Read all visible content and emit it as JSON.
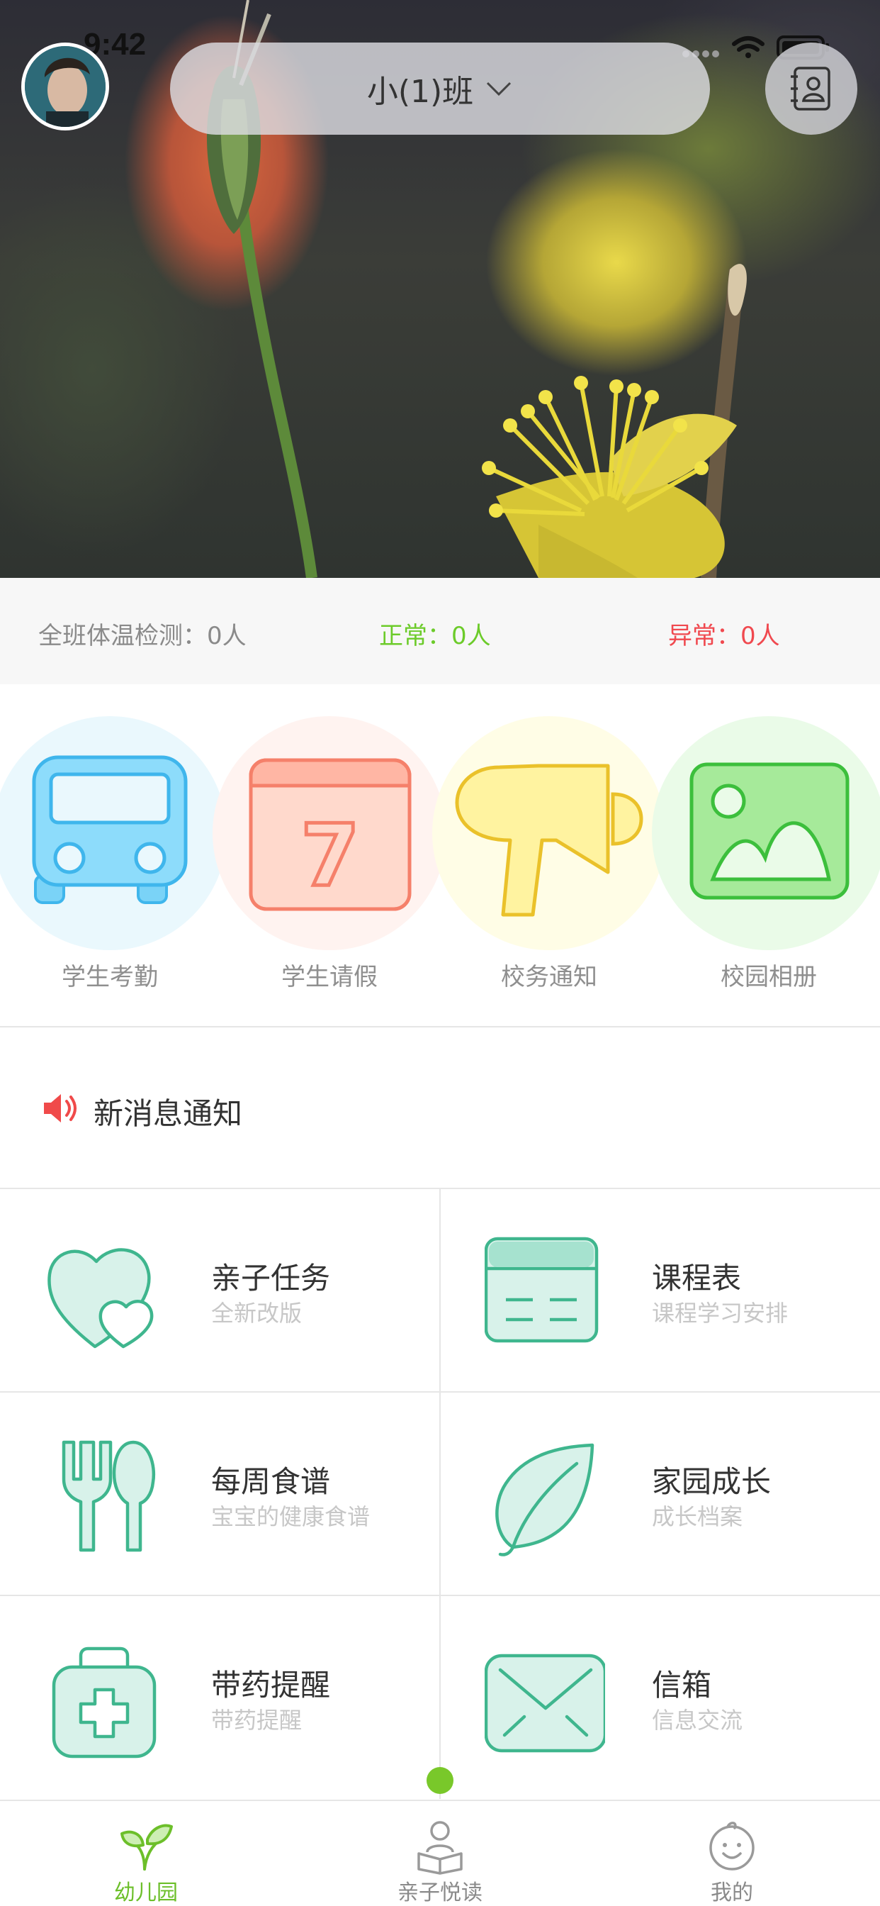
{
  "status_bar": {
    "time": "9:42"
  },
  "header": {
    "class_name": "小(1)班"
  },
  "temperature": {
    "total": "全班体温检测：0人",
    "normal": "正常：0人",
    "abnormal": "异常：0人"
  },
  "quick_actions": [
    {
      "label": "学生考勤",
      "icon": "bus-icon"
    },
    {
      "label": "学生请假",
      "icon": "calendar-icon"
    },
    {
      "label": "校务通知",
      "icon": "megaphone-icon"
    },
    {
      "label": "校园相册",
      "icon": "photo-album-icon"
    }
  ],
  "news": {
    "title": "新消息通知"
  },
  "features": [
    {
      "title": "亲子任务",
      "subtitle": "全新改版",
      "icon": "hearts-icon"
    },
    {
      "title": "课程表",
      "subtitle": "课程学习安排",
      "icon": "schedule-icon"
    },
    {
      "title": "每周食谱",
      "subtitle": "宝宝的健康食谱",
      "icon": "fork-spoon-icon"
    },
    {
      "title": "家园成长",
      "subtitle": "成长档案",
      "icon": "leaf-icon"
    },
    {
      "title": "带药提醒",
      "subtitle": "带药提醒",
      "icon": "medicine-kit-icon"
    },
    {
      "title": "信箱",
      "subtitle": "信息交流",
      "icon": "mail-icon"
    }
  ],
  "tabs": [
    {
      "label": "幼儿园",
      "active": true,
      "icon": "sprout-icon"
    },
    {
      "label": "亲子悦读",
      "active": false,
      "icon": "reading-icon"
    },
    {
      "label": "我的",
      "active": false,
      "icon": "smiley-face-icon"
    }
  ],
  "colors": {
    "accent_green": "#6cbf2a",
    "normal_text": "#6ccb2a",
    "abnormal_text": "#f0494f",
    "feature_icon": "#3fb68e"
  }
}
